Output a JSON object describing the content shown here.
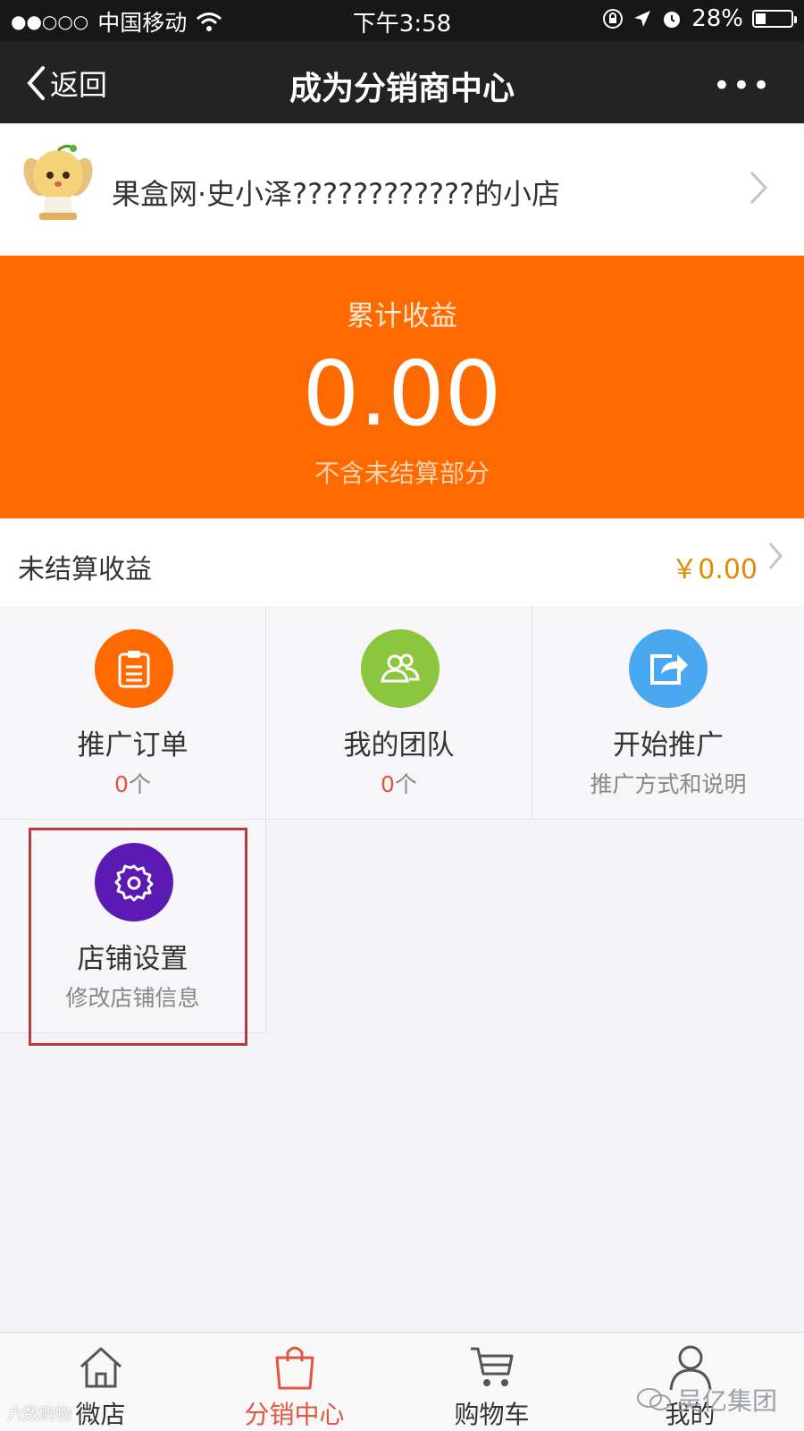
{
  "status_bar": {
    "signal": "●●○○○",
    "carrier": "中国移动",
    "time": "下午3:58",
    "battery": "28%",
    "battery_level": 0.28
  },
  "nav": {
    "back_label": "返回",
    "title": "成为分销商中心",
    "more": "•••"
  },
  "shop": {
    "name": "果盒网·史小泽????????????的小店"
  },
  "earnings": {
    "label": "累计收益",
    "value": "0.00",
    "note": "不含未结算部分"
  },
  "pending": {
    "label": "未结算收益",
    "value": "￥0.00"
  },
  "grid": [
    {
      "title": "推广订单",
      "count": "0",
      "unit": "个",
      "icon": "clipboard-icon",
      "color": "#ff6a00"
    },
    {
      "title": "我的团队",
      "count": "0",
      "unit": "个",
      "icon": "team-icon",
      "color": "#8cc63f"
    },
    {
      "title": "开始推广",
      "sub": "推广方式和说明",
      "icon": "share-icon",
      "color": "#4aa8f0"
    },
    {
      "title": "店铺设置",
      "sub": "修改店铺信息",
      "icon": "gear-icon",
      "color": "#5b1bb3"
    }
  ],
  "tabs": [
    {
      "label": "微店",
      "icon": "home-icon",
      "active": false
    },
    {
      "label": "分销中心",
      "icon": "bag-icon",
      "active": true
    },
    {
      "label": "购物车",
      "icon": "cart-icon",
      "active": false
    },
    {
      "label": "我的",
      "icon": "user-icon",
      "active": false
    }
  ],
  "watermarks": {
    "left": "六数购物",
    "right": "吴亿集团"
  },
  "colors": {
    "accent": "#ff6a00",
    "tab_active": "#e2553f",
    "highlight": "#b73a3e"
  }
}
